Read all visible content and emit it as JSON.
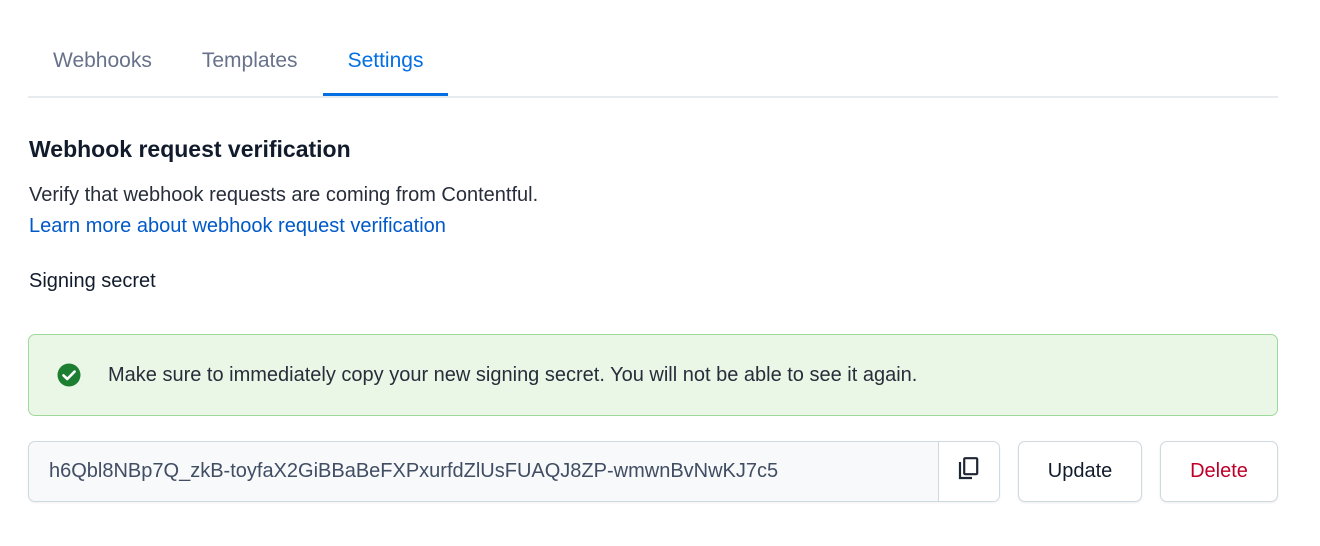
{
  "tabs": [
    {
      "label": "Webhooks",
      "active": false
    },
    {
      "label": "Templates",
      "active": false
    },
    {
      "label": "Settings",
      "active": true
    }
  ],
  "section": {
    "title": "Webhook request verification",
    "description": "Verify that webhook requests are coming from Contentful.",
    "link_text": "Learn more about webhook request verification"
  },
  "signing_secret": {
    "label": "Signing secret",
    "note": {
      "icon": "check-circle-icon",
      "text": "Make sure to immediately copy your new signing secret. You will not be able to see it again.",
      "color": "#1b7e31"
    },
    "value": "h6Qbl8NBp7Q_zkB-toyfaX2GiBBaBeFXPxurfdZlUsFUAQJ8ZP-wmwnBvNwKJ7c5",
    "copy_icon": "copy-icon",
    "update_label": "Update",
    "delete_label": "Delete"
  },
  "colors": {
    "accent": "#036fe3",
    "link": "#0059c8",
    "danger": "#bd002a",
    "success_bg": "#ebf7e6",
    "success_border": "#9fd99a"
  }
}
